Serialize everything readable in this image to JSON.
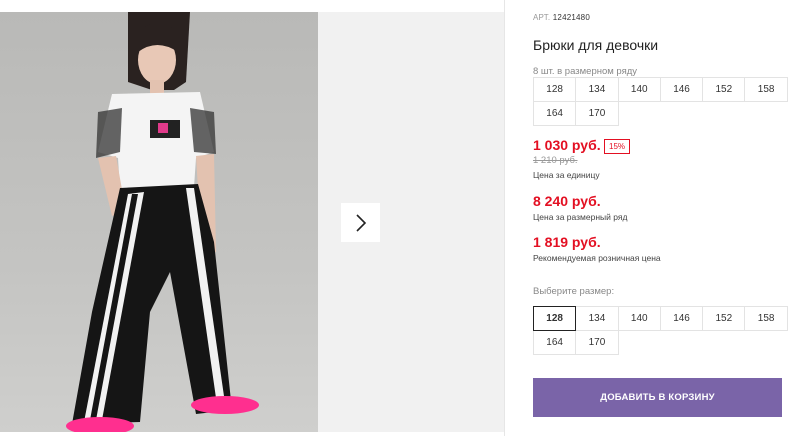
{
  "product": {
    "sku_label": "АРТ.",
    "sku": "12421480",
    "title": "Брюки для девочки"
  },
  "size_row": {
    "note": "8 шт. в размерном ряду",
    "sizes": [
      "128",
      "134",
      "140",
      "146",
      "152",
      "158",
      "164",
      "170"
    ]
  },
  "prices": {
    "unit_price": "1 030 руб.",
    "discount_badge": "15%",
    "old_price": "1 210 руб.",
    "unit_note": "Цена за единицу",
    "row_price": "8 240 руб.",
    "row_note": "Цена за размерный ряд",
    "retail_price": "1 819 руб.",
    "retail_note": "Рекомендуемая розничная цена"
  },
  "size_select": {
    "label": "Выберите размер:",
    "selected": "128",
    "sizes": [
      "128",
      "134",
      "140",
      "146",
      "152",
      "158",
      "164",
      "170"
    ]
  },
  "cart": {
    "add_label": "ДОБАВИТЬ В КОРЗИНУ"
  },
  "gallery": {
    "arrow_icon": "chevron-right-icon"
  },
  "colors": {
    "price_red": "#e30f22",
    "button_purple": "#7a64a8"
  }
}
